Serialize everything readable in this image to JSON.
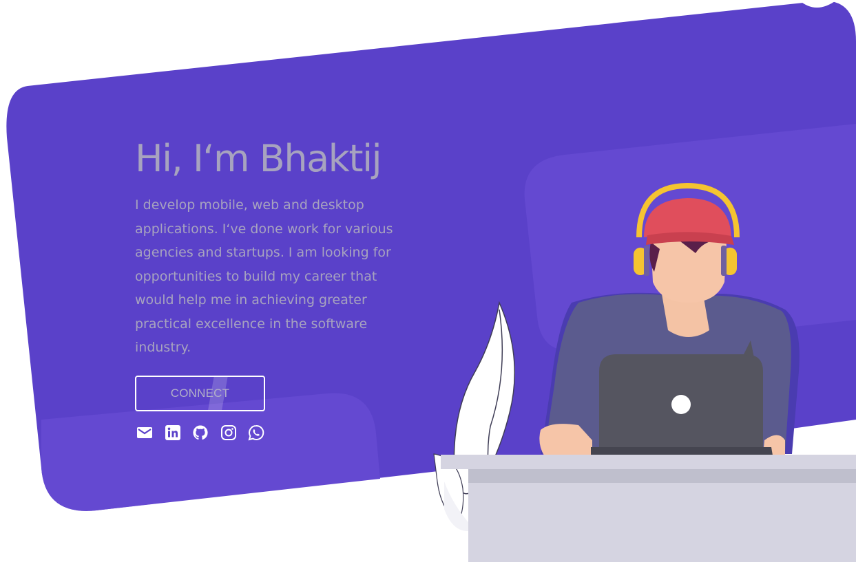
{
  "hero": {
    "title": "Hi, I‘m Bhaktij",
    "description": "I develop mobile, web and desktop applications. I‘ve done work for various agencies and startups. I am looking for opportunities to build my career that would help me in achieving greater practical excellence in the software industry.",
    "cta_label": "CONNECT"
  },
  "socials": [
    {
      "name": "email",
      "icon": "mail-icon"
    },
    {
      "name": "linkedin",
      "icon": "linkedin-icon"
    },
    {
      "name": "github",
      "icon": "github-icon"
    },
    {
      "name": "instagram",
      "icon": "instagram-icon"
    },
    {
      "name": "whatsapp",
      "icon": "whatsapp-icon"
    }
  ],
  "colors": {
    "hero_background": "#5a41c9",
    "hero_highlight": "#6a4fd3",
    "text": "#a7a3bf",
    "desk": "#d5d4e1",
    "laptop": "#555560",
    "cap": "#e04e5c",
    "headphones": "#f5c431",
    "shirt": "#5a5a8c",
    "skin": "#f6c5a8"
  }
}
